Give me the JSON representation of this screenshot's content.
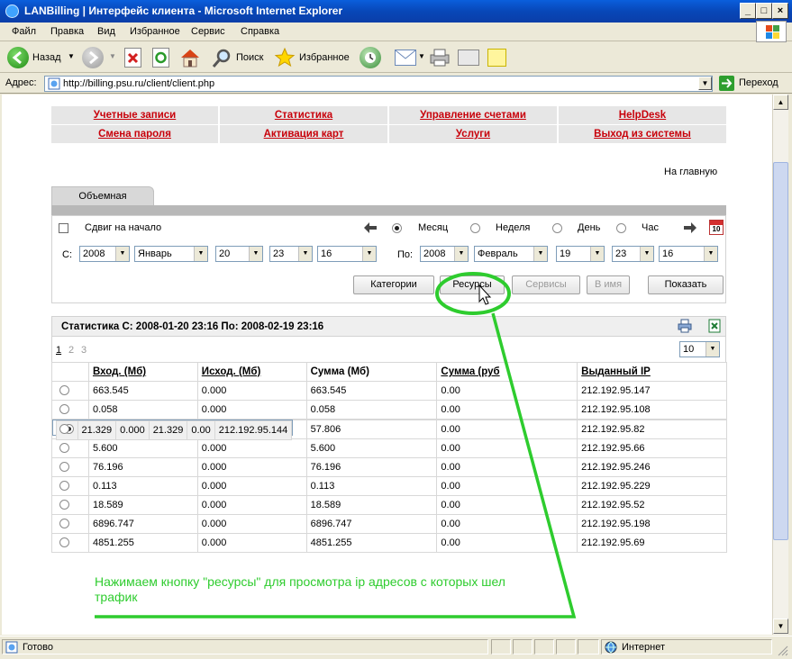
{
  "window": {
    "title": "LANBilling | Интерфейс клиента - Microsoft Internet Explorer"
  },
  "menu": [
    "Файл",
    "Правка",
    "Вид",
    "Избранное",
    "Сервис",
    "Справка"
  ],
  "toolbar": {
    "back": "Назад",
    "search": "Поиск",
    "favorites": "Избранное"
  },
  "address": {
    "label": "Адрес:",
    "url": "http://billing.psu.ru/client/client.php",
    "go": "Переход"
  },
  "nav": {
    "row1": [
      "Учетные записи",
      "Статистика",
      "Управление счетами",
      "HelpDesk"
    ],
    "row2": [
      "Смена пароля",
      "Активация карт",
      "Услуги",
      "Выход из системы"
    ]
  },
  "home_link": "На главную",
  "tab": "Объемная",
  "filter": {
    "shift_label": "Сдвиг на начало",
    "periods": [
      "Месяц",
      "Неделя",
      "День",
      "Час"
    ],
    "selected_period": "Месяц",
    "from_label": "С:",
    "to_label": "По:",
    "from": {
      "year": "2008",
      "month": "Январь",
      "day": "20",
      "hour": "23",
      "minute": "16"
    },
    "to": {
      "year": "2008",
      "month": "Февраль",
      "day": "19",
      "hour": "23",
      "minute": "16"
    }
  },
  "buttons": {
    "categories": "Категории",
    "resources": "Ресурсы",
    "services": "Сервисы",
    "byname": "В имя",
    "show": "Показать"
  },
  "stats": {
    "title": "Статистика С: 2008-01-20 23:16 По: 2008-02-19 23:16",
    "pages": [
      "1",
      "2",
      "3"
    ],
    "page_size": "10",
    "columns": [
      "Вход. (Мб)",
      "Исход. (Мб)",
      "Сумма (Мб)",
      "Сумма (руб",
      "Выданный IP"
    ],
    "selected_row": 2,
    "rows": [
      [
        "663.545",
        "0.000",
        "663.545",
        "0.00",
        "212.192.95.147"
      ],
      [
        "0.058",
        "0.000",
        "0.058",
        "0.00",
        "212.192.95.108"
      ],
      [
        "21.329",
        "0.000",
        "21.329",
        "0.00",
        "212.192.95.144"
      ],
      [
        "57.806",
        "0.000",
        "57.806",
        "0.00",
        "212.192.95.82"
      ],
      [
        "5.600",
        "0.000",
        "5.600",
        "0.00",
        "212.192.95.66"
      ],
      [
        "76.196",
        "0.000",
        "76.196",
        "0.00",
        "212.192.95.246"
      ],
      [
        "0.113",
        "0.000",
        "0.113",
        "0.00",
        "212.192.95.229"
      ],
      [
        "18.589",
        "0.000",
        "18.589",
        "0.00",
        "212.192.95.52"
      ],
      [
        "6896.747",
        "0.000",
        "6896.747",
        "0.00",
        "212.192.95.198"
      ],
      [
        "4851.255",
        "0.000",
        "4851.255",
        "0.00",
        "212.192.95.69"
      ]
    ]
  },
  "annotation": {
    "line1": "Нажимаем кнопку \"ресурсы\" для просмотра ip адресов с которых шел",
    "line2": "трафик",
    "color": "#2ecc2e"
  },
  "status": {
    "left": "Готово",
    "zone": "Интернет"
  }
}
